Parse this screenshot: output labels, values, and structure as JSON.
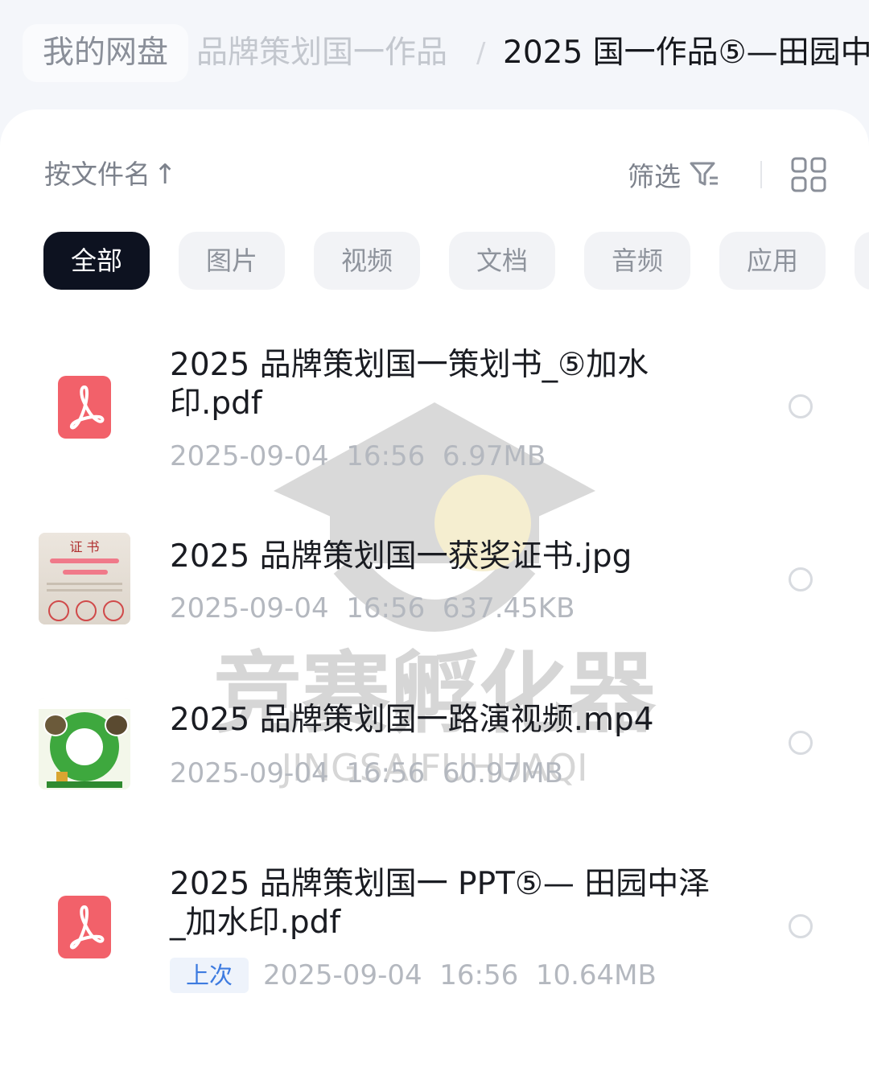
{
  "breadcrumb": {
    "root": "我的网盘",
    "parent": "品牌策划国一作品",
    "separator": "/",
    "current": "2025 国一作品⑤—田园中"
  },
  "toolbar": {
    "sort_label": "按文件名",
    "sort_arrow": "↑",
    "filter_label": "筛选",
    "filter_icon": "filter-icon",
    "view_icon": "grid-view-icon"
  },
  "tabs": [
    {
      "label": "全部",
      "active": true
    },
    {
      "label": "图片",
      "active": false
    },
    {
      "label": "视频",
      "active": false
    },
    {
      "label": "文档",
      "active": false
    },
    {
      "label": "音频",
      "active": false
    },
    {
      "label": "应用",
      "active": false
    }
  ],
  "files": [
    {
      "name": "2025 品牌策划国一策划书_⑤加水印.pdf",
      "date": "2025-09-04",
      "time": "16:56",
      "size": "6.97MB",
      "icon": "pdf-icon"
    },
    {
      "name": "2025 品牌策划国一获奖证书.jpg",
      "date": "2025-09-04",
      "time": "16:56",
      "size": "637.45KB",
      "icon": "image-thumbnail",
      "thumb_text": "证 书"
    },
    {
      "name": "2025 品牌策划国一路演视频.mp4",
      "date": "2025-09-04",
      "time": "16:56",
      "size": "60.97MB",
      "icon": "video-thumbnail"
    },
    {
      "name": "2025 品牌策划国一 PPT⑤— 田园中泽_加水印.pdf",
      "badge": "上次",
      "date": "2025-09-04",
      "time": "16:56",
      "size": "10.64MB",
      "icon": "pdf-icon"
    }
  ],
  "watermark": {
    "text": "竞赛孵化器",
    "subtext": "JINGSAIFUHUAQI"
  },
  "colors": {
    "active_tab": "#0d1220",
    "pdf_red": "#f2616a",
    "badge_blue": "#3d7be0"
  }
}
